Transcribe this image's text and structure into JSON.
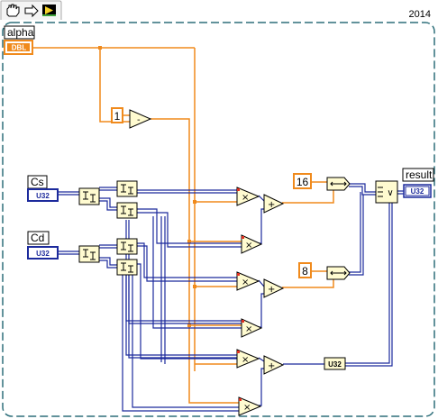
{
  "structure": {
    "year": "2014",
    "toolbar_icons": [
      "hand-icon",
      "arrow-icon",
      "run-icon"
    ]
  },
  "controls": {
    "alpha": {
      "label": "alpha",
      "type": "DBL"
    },
    "cs": {
      "label": "Cs",
      "type": "U32"
    },
    "cd": {
      "label": "Cd",
      "type": "U32"
    }
  },
  "indicator": {
    "label": "result",
    "type": "U32"
  },
  "constants": {
    "one": "1",
    "sixteen": "16",
    "eight": "8"
  },
  "nodes": {
    "subtract": "-",
    "multiply": "×",
    "add": "+",
    "or": "∨",
    "convert_u32": "U32"
  },
  "colors": {
    "orange_wire": "#f08a1c",
    "blue_wire": "#1c2a9c",
    "frame": "#2e6f7a",
    "node_fill": "#fffbd0"
  }
}
